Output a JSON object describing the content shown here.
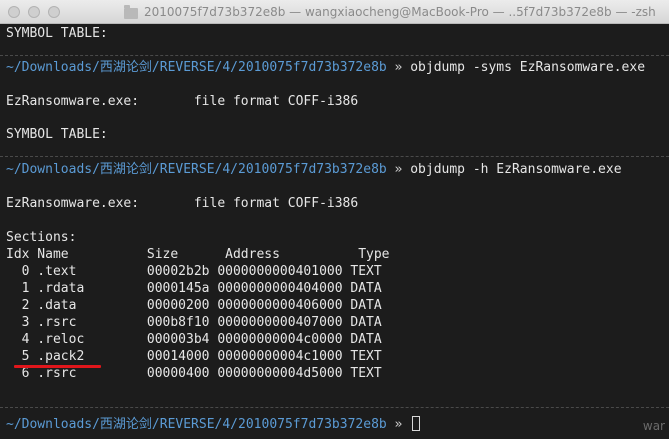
{
  "window": {
    "title": "2010075f7d73b372e8b — wangxiaocheng@MacBook-Pro — ..5f7d73b372e8b — -zsh"
  },
  "lines": {
    "l0": "SYMBOL TABLE:",
    "prompt1_path": "~/Downloads/西湖论剑/REVERSE/4/2010075f7d73b372e8b",
    "prompt1_arrow": " » ",
    "prompt1_cmd": "objdump -syms EzRansomware.exe",
    "l_ff1": "EzRansomware.exe:       file format COFF-i386",
    "l_sym2": "SYMBOL TABLE:",
    "prompt2_path": "~/Downloads/西湖论剑/REVERSE/4/2010075f7d73b372e8b",
    "prompt2_arrow": " » ",
    "prompt2_cmd": "objdump -h EzRansomware.exe",
    "l_ff2": "EzRansomware.exe:       file format COFF-i386",
    "sections_label": "Sections:",
    "header": "Idx Name          Size      Address          Type",
    "rows": [
      "  0 .text         00002b2b 0000000000401000 TEXT",
      "  1 .rdata        0000145a 0000000000404000 DATA",
      "  2 .data         00000200 0000000000406000 DATA",
      "  3 .rsrc         000b8f10 0000000000407000 DATA",
      "  4 .reloc        000003b4 00000000004c0000 DATA",
      "  5 .pack2        00014000 00000000004c1000 TEXT",
      "  6 .rsrc         00000400 00000000004d5000 TEXT"
    ],
    "prompt3_path": "~/Downloads/西湖论剑/REVERSE/4/2010075f7d73b372e8b",
    "prompt3_arrow": " » "
  },
  "watermark": "war"
}
